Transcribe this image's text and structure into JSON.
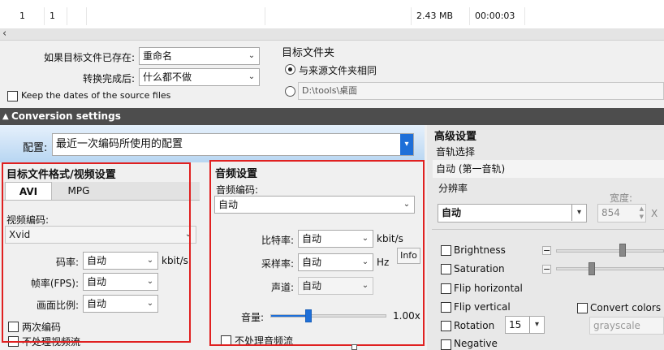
{
  "file_row": {
    "col1": "1",
    "col2": "1",
    "size": "2.43 MB",
    "duration": "00:00:03"
  },
  "scroll_left_arrow": "‹",
  "output": {
    "exists_label": "如果目标文件已存在:",
    "exists_value": "重命名",
    "after_label": "转换完成后:",
    "after_value": "什么都不做",
    "keep_dates_label": "Keep the dates of the source files",
    "target_folder_label": "目标文件夹",
    "same_folder_label": "与来源文件夹相同",
    "custom_path": "D:\\tools\\桌面"
  },
  "conversion_settings": "Conversion settings",
  "config": {
    "label": "配置:",
    "value": "最近一次编码所使用的配置"
  },
  "video": {
    "title": "目标文件格式/视频设置",
    "tab_avi": "AVI",
    "tab_mpg": "MPG",
    "codec_label": "视频编码:",
    "codec_value": "Xvid",
    "bitrate_label": "码率:",
    "bitrate_value": "自动",
    "bitrate_unit": "kbit/s",
    "fps_label": "帧率(FPS):",
    "fps_value": "自动",
    "aspect_label": "画面比例:",
    "aspect_value": "自动",
    "two_pass": "两次编码",
    "no_video": "不处理视频流"
  },
  "audio": {
    "title": "音频设置",
    "codec_label": "音频编码:",
    "codec_value": "自动",
    "bitrate_label": "比特率:",
    "bitrate_value": "自动",
    "bitrate_unit": "kbit/s",
    "sample_label": "采样率:",
    "sample_value": "自动",
    "sample_unit": "Hz",
    "info": "Info",
    "channel_label": "声道:",
    "channel_value": "自动",
    "volume_label": "音量:",
    "volume_value": "1.00x",
    "volume_fraction": 0.33,
    "no_audio": "不处理音频流"
  },
  "advanced": {
    "title": "高级设置",
    "track_label": "音轨选择",
    "track_value": "自动 (第一音轨)",
    "resolution_label": "分辨率",
    "resolution_value": "自动",
    "width_label": "宽度:",
    "width_value": "854",
    "x": "X",
    "brightness": "Brightness",
    "saturation": "Saturation",
    "flip_h": "Flip horizontal",
    "flip_v": "Flip vertical",
    "rotation": "Rotation",
    "rotation_value": "15",
    "negative": "Negative",
    "convert_colors": "Convert colors to",
    "grayscale": "grayscale",
    "minus": "−",
    "brightness_fraction": 0.62,
    "saturation_fraction": 0.33
  },
  "glyphs": {
    "down": "▾",
    "dropdown": "⌄",
    "spin_up": "▲",
    "spin_down": "▼"
  },
  "colors": {
    "red_box": "#e02020",
    "dark_bar": "#4d4d4d",
    "blue_accent": "#1e6fd8"
  }
}
